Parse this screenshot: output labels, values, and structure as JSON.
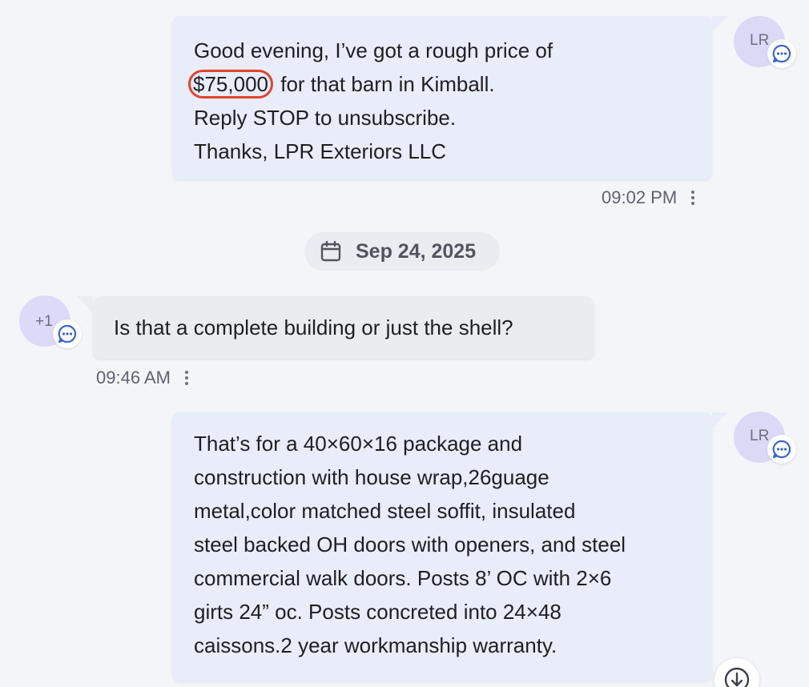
{
  "messages": [
    {
      "direction": "outgoing",
      "avatar_initials": "LR",
      "badge_icon": "message-dots-icon",
      "lines": {
        "l1": "Good evening, I’ve got a rough price of",
        "l2_price": "$75,000",
        "l2_rest": "for that barn in Kimball.",
        "l3": "Reply STOP to unsubscribe.",
        "l4": "Thanks, LPR Exteriors LLC"
      },
      "time": "09:02 PM"
    },
    {
      "direction": "incoming",
      "avatar_initials": "+1",
      "badge_icon": "message-dots-icon",
      "text": "Is that a complete building or just the shell?",
      "time": "09:46 AM"
    },
    {
      "direction": "outgoing",
      "avatar_initials": "LR",
      "badge_icon": "message-dots-icon",
      "lines": [
        "That’s for a 40×60×16 package and",
        "construction with house wrap,26guage",
        "metal,color matched steel soffit, insulated",
        "steel backed OH doors with openers, and steel",
        "commercial walk doors. Posts 8’ OC with 2×6",
        "girts 24” oc. Posts concreted into 24×48",
        "caissons.2 year workmanship warranty."
      ]
    }
  ],
  "date_divider": {
    "icon": "calendar-icon",
    "label": "Sep 24, 2025"
  },
  "scroll_button_icon": "arrow-down-circle-icon",
  "colors": {
    "background": "#f4f5f9",
    "outgoing_bubble": "#e9ecf9",
    "incoming_bubble": "#ebecf0",
    "avatar": "#dcd9f7",
    "badge_icon": "#3a63d6",
    "highlight_circle": "#e0452b"
  }
}
